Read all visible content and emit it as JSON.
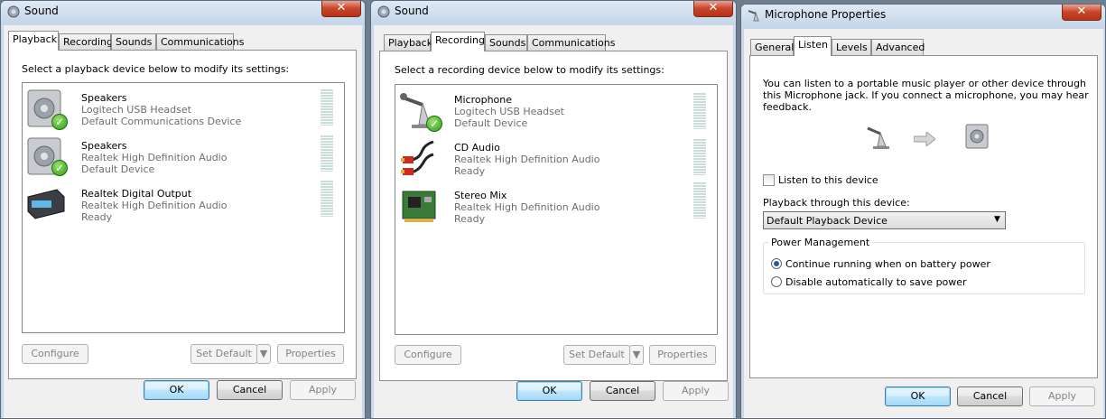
{
  "window1": {
    "title": "Sound",
    "close": "✕",
    "tabs": [
      "Playback",
      "Recording",
      "Sounds",
      "Communications"
    ],
    "instruction": "Select a playback device below to modify its settings:",
    "devices": [
      {
        "name": "Speakers",
        "line1": "Logitech USB Headset",
        "line2": "Default Communications Device"
      },
      {
        "name": "Speakers",
        "line1": "Realtek High Definition Audio",
        "line2": "Default Device"
      },
      {
        "name": "Realtek Digital Output",
        "line1": "Realtek High Definition Audio",
        "line2": "Ready"
      }
    ],
    "configure": "Configure",
    "set_default": "Set Default",
    "properties": "Properties",
    "ok": "OK",
    "cancel": "Cancel",
    "apply": "Apply"
  },
  "window2": {
    "title": "Sound",
    "close": "✕",
    "tabs": [
      "Playback",
      "Recording",
      "Sounds",
      "Communications"
    ],
    "instruction": "Select a recording device below to modify its settings:",
    "devices": [
      {
        "name": "Microphone",
        "line1": "Logitech USB Headset",
        "line2": "Default Device"
      },
      {
        "name": "CD Audio",
        "line1": "Realtek High Definition Audio",
        "line2": "Ready"
      },
      {
        "name": "Stereo Mix",
        "line1": "Realtek High Definition Audio",
        "line2": "Ready"
      }
    ],
    "configure": "Configure",
    "set_default": "Set Default",
    "properties": "Properties",
    "ok": "OK",
    "cancel": "Cancel",
    "apply": "Apply"
  },
  "window3": {
    "title": "Microphone Properties",
    "close": "✕",
    "tabs": [
      "General",
      "Listen",
      "Levels",
      "Advanced"
    ],
    "desc1": "You can listen to a portable music player or other device through",
    "desc2": "this Microphone jack.  If you connect a microphone, you may hear",
    "desc3": "feedback.",
    "listen_label": "Listen to this device",
    "playback_through_label": "Playback through this device:",
    "playback_select": "Default Playback Device",
    "power_group": "Power Management",
    "radio1": "Continue running when on battery power",
    "radio2": "Disable automatically to save power",
    "ok": "OK",
    "cancel": "Cancel",
    "apply": "Apply"
  }
}
